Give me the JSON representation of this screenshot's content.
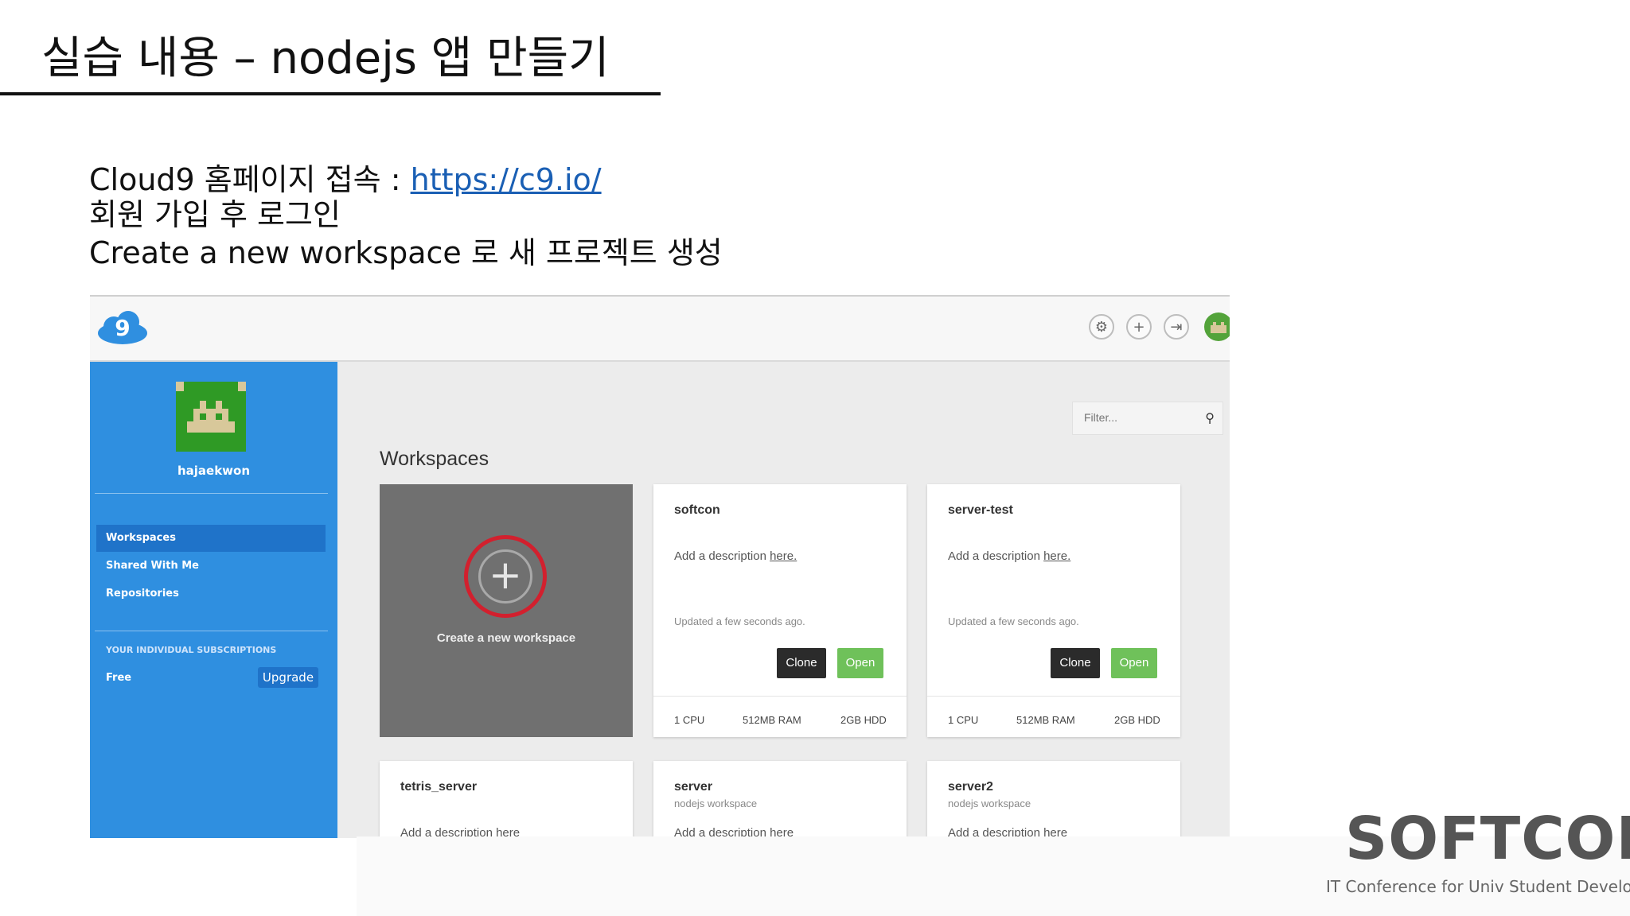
{
  "slide": {
    "title": "실습 내용 – nodejs 앱 만들기",
    "bullet1_prefix": "Cloud9 홈페이지 접속 : ",
    "bullet1_link": "https://c9.io/",
    "bullet2": "회원 가입 후 로그인",
    "bullet3": "Create a new workspace 로 새 프로젝트 생성"
  },
  "app": {
    "header_icons": [
      "gear-icon",
      "plus-icon",
      "logout-icon",
      "user-avatar"
    ],
    "sidebar": {
      "username": "hajaekwon",
      "nav": [
        "Workspaces",
        "Shared With Me",
        "Repositories"
      ],
      "active_nav": "Workspaces",
      "subscriptions_heading": "YOUR INDIVIDUAL SUBSCRIPTIONS",
      "plan": "Free",
      "upgrade_label": "Upgrade"
    },
    "filter_placeholder": "Filter...",
    "heading": "Workspaces",
    "create_label": "Create a new workspace",
    "workspaces": [
      {
        "name": "softcon",
        "desc_prefix": "Add a description ",
        "desc_link": "here.",
        "updated": "Updated a few seconds ago.",
        "clone": "Clone",
        "open": "Open",
        "cpu": "1 CPU",
        "ram": "512MB RAM",
        "hdd": "2GB HDD"
      },
      {
        "name": "server-test",
        "desc_prefix": "Add a description ",
        "desc_link": "here.",
        "updated": "Updated a few seconds ago.",
        "clone": "Clone",
        "open": "Open",
        "cpu": "1 CPU",
        "ram": "512MB RAM",
        "hdd": "2GB HDD"
      },
      {
        "name": "tetris_server",
        "subtitle": "",
        "desc": "Add a description here"
      },
      {
        "name": "server",
        "subtitle": "nodejs workspace",
        "desc": "Add a description here"
      },
      {
        "name": "server2",
        "subtitle": "nodejs workspace",
        "desc": "Add a description here"
      }
    ],
    "colors": {
      "sidebar": "#2f8fe0",
      "open_button": "#6fc15a",
      "clone_button": "#2b2b2b",
      "create_card": "#707070",
      "highlight_ring": "#d2202e"
    }
  },
  "branding": {
    "name": "SOFTCON",
    "tagline": "IT Conference for Univ Student Developer"
  }
}
